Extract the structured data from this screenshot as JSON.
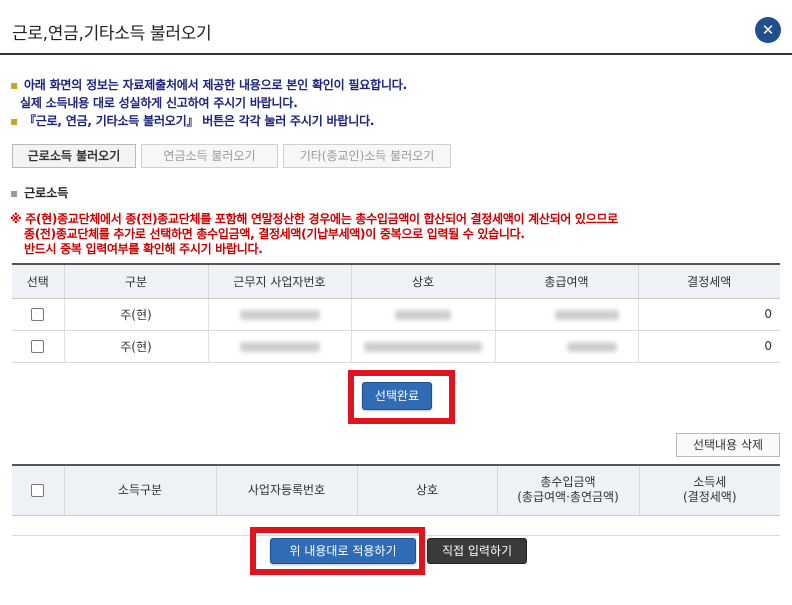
{
  "dialog": {
    "title": "근로,연금,기타소득 불러오기",
    "close_icon": "close-icon"
  },
  "notices": [
    "아래 화면의 정보는 자료제출처에서 제공한 내용으로 본인 확인이 필요합니다.",
    "실제 소득내용 대로 성실하게 신고하여 주시기 바랍니다.",
    "『근로, 연금, 기타소득 불러오기』 버튼은 각각 눌러 주시기 바랍니다."
  ],
  "load_buttons": [
    "근로소득 불러오기",
    "연금소득 불러오기",
    "기타(종교인)소득 불러오기"
  ],
  "section_title": "근로소득",
  "warning": [
    "※ 주(현)종교단체에서 종(전)종교단체를 포함해 연말정산한 경우에는 총수입금액이 합산되어 결정세액이 계산되어 있으므로",
    "종(전)종교단체를 추가로 선택하면 총수입금액, 결정세액(기납부세액)이 중복으로 입력될 수 있습니다.",
    "반드시 중복 입력여부를 확인해 주시기 바랍니다."
  ],
  "table1": {
    "headers": [
      "선택",
      "구분",
      "근무지 사업자번호",
      "상호",
      "총급여액",
      "결정세액"
    ],
    "rows": [
      {
        "type": "주(현)",
        "tax": "0"
      },
      {
        "type": "주(현)",
        "tax": "0"
      }
    ]
  },
  "complete_button": "선택완료",
  "delete_button": "선택내용 삭제",
  "table2": {
    "headers": [
      "소득구분",
      "사업자등록번호",
      "상호",
      "총수입금액",
      "(총급여액·총연금액)",
      "소득세",
      "(결정세액)"
    ]
  },
  "apply_button": "위 내용대로 적용하기",
  "manual_button": "직접 입력하기",
  "colors": {
    "primary": "#2f6cb3",
    "highlight": "#e0141e",
    "warning": "#cc0000",
    "notice": "#1a237e"
  }
}
